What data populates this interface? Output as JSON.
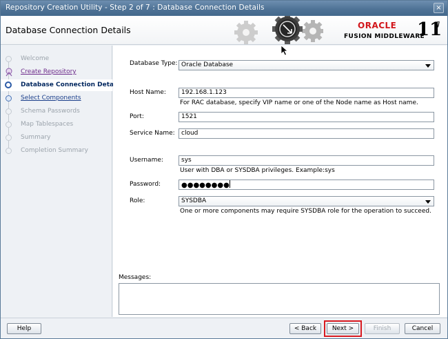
{
  "window": {
    "title": "Repository Creation Utility - Step 2 of 7 : Database Connection Details",
    "close_glyph": "×"
  },
  "header": {
    "page_title": "Database Connection Details",
    "brand": {
      "oracle": "ORACLE",
      "product": "FUSION MIDDLEWARE",
      "version_num": "11",
      "version_sup": "g"
    }
  },
  "nav": {
    "items": [
      {
        "label": "Welcome",
        "state": "disabled"
      },
      {
        "label": "Create Repository",
        "state": "visited"
      },
      {
        "label": "Database Connection Details",
        "state": "current"
      },
      {
        "label": "Select Components",
        "state": "link"
      },
      {
        "label": "Schema Passwords",
        "state": "disabled"
      },
      {
        "label": "Map Tablespaces",
        "state": "disabled"
      },
      {
        "label": "Summary",
        "state": "disabled"
      },
      {
        "label": "Completion Summary",
        "state": "disabled"
      }
    ]
  },
  "form": {
    "database_type": {
      "label": "Database Type:",
      "value": "Oracle Database"
    },
    "host_name": {
      "label": "Host Name:",
      "value": "192.168.1.123",
      "hint": "For RAC database, specify VIP name or one of the Node name as Host name."
    },
    "port": {
      "label": "Port:",
      "value": "1521"
    },
    "service_name": {
      "label": "Service Name:",
      "value": "cloud"
    },
    "username": {
      "label": "Username:",
      "value": "sys",
      "hint": "User with DBA or SYSDBA privileges. Example:sys"
    },
    "password": {
      "label": "Password:",
      "value": "●●●●●●●●"
    },
    "role": {
      "label": "Role:",
      "value": "SYSDBA",
      "hint": "One or more components may require SYSDBA role for the operation to succeed."
    }
  },
  "messages": {
    "label": "Messages:",
    "text": ""
  },
  "buttons": {
    "help": "Help",
    "back": "< Back",
    "next": "Next >",
    "finish": "Finish",
    "cancel": "Cancel"
  },
  "colors": {
    "titlebar": "#4f7396",
    "oracle_red": "#d2161b",
    "highlight_box": "#d8191f"
  }
}
